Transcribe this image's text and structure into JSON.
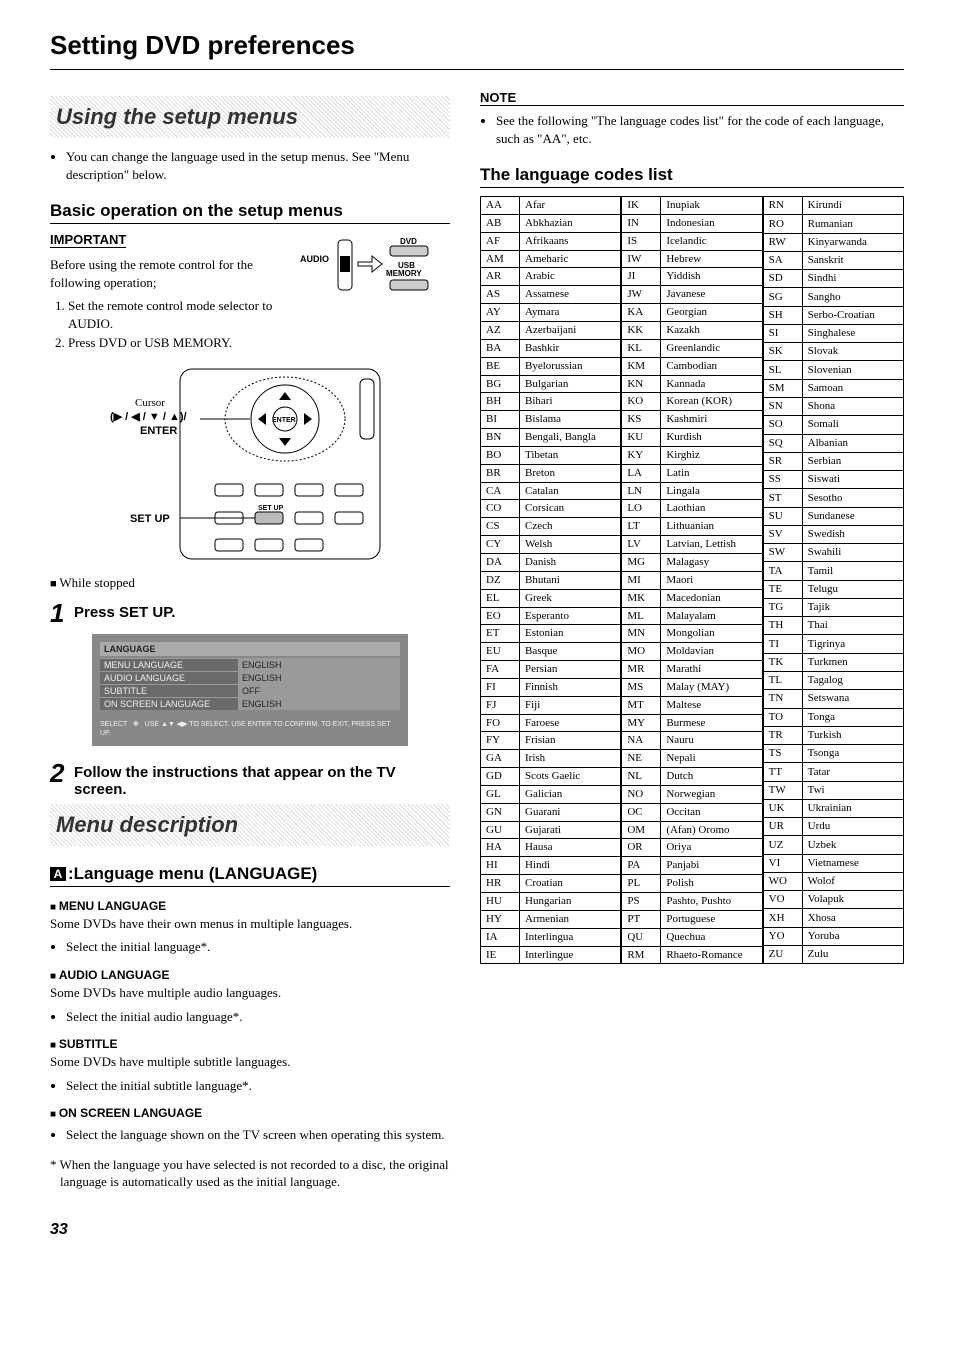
{
  "page_title": "Setting DVD preferences",
  "page_number": "33",
  "left": {
    "h_using": "Using the setup menus",
    "intro_bullet": "You can change the language used in the setup menus. See \"Menu description\" below.",
    "h_basic": "Basic operation on the setup menus",
    "important_label": "IMPORTANT",
    "important_intro": "Before using the remote control for the following operation;",
    "important_1": "Set the remote control mode selector to AUDIO.",
    "important_2": "Press DVD or USB MEMORY.",
    "switch_audio": "AUDIO",
    "switch_dvd": "DVD",
    "switch_usb": "USB MEMORY",
    "remote_cursor_label": "Cursor",
    "remote_cursor_arrows": "(▶ / ◀ / ▼ / ▲)/",
    "remote_enter": "ENTER",
    "remote_setup": "SET UP",
    "while_stopped": "While stopped",
    "step1_num": "1",
    "step1_text": "Press SET UP.",
    "osd_title": "LANGUAGE",
    "osd_rows": [
      {
        "k": "MENU LANGUAGE",
        "v": "ENGLISH"
      },
      {
        "k": "AUDIO LANGUAGE",
        "v": "ENGLISH"
      },
      {
        "k": "SUBTITLE",
        "v": "OFF"
      },
      {
        "k": "ON SCREEN LANGUAGE",
        "v": "ENGLISH"
      }
    ],
    "osd_foot1": "SELECT",
    "osd_foot2": "USE ▲▼ ◀▶ TO SELECT. USE ENTER TO CONFIRM. TO EXIT, PRESS SET UP.",
    "step2_num": "2",
    "step2_text": "Follow the instructions that appear on the TV screen.",
    "h_menu_desc": "Menu description",
    "lang_icon": "A",
    "h_language": ":Language menu (LANGUAGE)",
    "ml_h": "MENU LANGUAGE",
    "ml_t": "Some DVDs have their own menus in multiple languages.",
    "ml_b": "Select the initial language*.",
    "al_h": "AUDIO LANGUAGE",
    "al_t": "Some DVDs have multiple audio languages.",
    "al_b": "Select the initial audio language*.",
    "st_h": "SUBTITLE",
    "st_t": "Some DVDs have multiple subtitle languages.",
    "st_b": "Select the initial subtitle language*.",
    "os_h": "ON SCREEN LANGUAGE",
    "os_b": "Select the language shown on the TV screen when operating this system.",
    "footnote": "* When the language you have selected is not recorded to a disc, the original language is automatically used as the initial language."
  },
  "right": {
    "note_label": "NOTE",
    "note_bullet": "See the following \"The language codes list\" for the code of each language, such as \"AA\", etc.",
    "h_codes": "The language codes list",
    "col1": [
      [
        "AA",
        "Afar"
      ],
      [
        "AB",
        "Abkhazian"
      ],
      [
        "AF",
        "Afrikaans"
      ],
      [
        "AM",
        "Ameharic"
      ],
      [
        "AR",
        "Arabic"
      ],
      [
        "AS",
        "Assamese"
      ],
      [
        "AY",
        "Aymara"
      ],
      [
        "AZ",
        "Azerbaijani"
      ],
      [
        "BA",
        "Bashkir"
      ],
      [
        "BE",
        "Byelorussian"
      ],
      [
        "BG",
        "Bulgarian"
      ],
      [
        "BH",
        "Bihari"
      ],
      [
        "BI",
        "Bislama"
      ],
      [
        "BN",
        "Bengali, Bangla"
      ],
      [
        "BO",
        "Tibetan"
      ],
      [
        "BR",
        "Breton"
      ],
      [
        "CA",
        "Catalan"
      ],
      [
        "CO",
        "Corsican"
      ],
      [
        "CS",
        "Czech"
      ],
      [
        "CY",
        "Welsh"
      ],
      [
        "DA",
        "Danish"
      ],
      [
        "DZ",
        "Bhutani"
      ],
      [
        "EL",
        "Greek"
      ],
      [
        "EO",
        "Esperanto"
      ],
      [
        "ET",
        "Estonian"
      ],
      [
        "EU",
        "Basque"
      ],
      [
        "FA",
        "Persian"
      ],
      [
        "FI",
        "Finnish"
      ],
      [
        "FJ",
        "Fiji"
      ],
      [
        "FO",
        "Faroese"
      ],
      [
        "FY",
        "Frisian"
      ],
      [
        "GA",
        "Irish"
      ],
      [
        "GD",
        "Scots Gaelic"
      ],
      [
        "GL",
        "Galician"
      ],
      [
        "GN",
        "Guarani"
      ],
      [
        "GU",
        "Gujarati"
      ],
      [
        "HA",
        "Hausa"
      ],
      [
        "HI",
        "Hindi"
      ],
      [
        "HR",
        "Croatian"
      ],
      [
        "HU",
        "Hungarian"
      ],
      [
        "HY",
        "Armenian"
      ],
      [
        "IA",
        "Interlingua"
      ],
      [
        "IE",
        "Interlingue"
      ]
    ],
    "col2": [
      [
        "IK",
        "Inupiak"
      ],
      [
        "IN",
        "Indonesian"
      ],
      [
        "IS",
        "Icelandic"
      ],
      [
        "IW",
        "Hebrew"
      ],
      [
        "JI",
        "Yiddish"
      ],
      [
        "JW",
        "Javanese"
      ],
      [
        "KA",
        "Georgian"
      ],
      [
        "KK",
        "Kazakh"
      ],
      [
        "KL",
        "Greenlandic"
      ],
      [
        "KM",
        "Cambodian"
      ],
      [
        "KN",
        "Kannada"
      ],
      [
        "KO",
        "Korean (KOR)"
      ],
      [
        "KS",
        "Kashmiri"
      ],
      [
        "KU",
        "Kurdish"
      ],
      [
        "KY",
        "Kirghiz"
      ],
      [
        "LA",
        "Latin"
      ],
      [
        "LN",
        "Lingala"
      ],
      [
        "LO",
        "Laothian"
      ],
      [
        "LT",
        "Lithuanian"
      ],
      [
        "LV",
        "Latvian, Lettish"
      ],
      [
        "MG",
        "Malagasy"
      ],
      [
        "MI",
        "Maori"
      ],
      [
        "MK",
        "Macedonian"
      ],
      [
        "ML",
        "Malayalam"
      ],
      [
        "MN",
        "Mongolian"
      ],
      [
        "MO",
        "Moldavian"
      ],
      [
        "MR",
        "Marathi"
      ],
      [
        "MS",
        "Malay (MAY)"
      ],
      [
        "MT",
        "Maltese"
      ],
      [
        "MY",
        "Burmese"
      ],
      [
        "NA",
        "Nauru"
      ],
      [
        "NE",
        "Nepali"
      ],
      [
        "NL",
        "Dutch"
      ],
      [
        "NO",
        "Norwegian"
      ],
      [
        "OC",
        "Occitan"
      ],
      [
        "OM",
        "(Afan) Oromo"
      ],
      [
        "OR",
        "Oriya"
      ],
      [
        "PA",
        "Panjabi"
      ],
      [
        "PL",
        "Polish"
      ],
      [
        "PS",
        "Pashto, Pushto"
      ],
      [
        "PT",
        "Portuguese"
      ],
      [
        "QU",
        "Quechua"
      ],
      [
        "RM",
        "Rhaeto-Romance"
      ]
    ],
    "col3": [
      [
        "RN",
        "Kirundi"
      ],
      [
        "RO",
        "Rumanian"
      ],
      [
        "RW",
        "Kinyarwanda"
      ],
      [
        "SA",
        "Sanskrit"
      ],
      [
        "SD",
        "Sindhi"
      ],
      [
        "SG",
        "Sangho"
      ],
      [
        "SH",
        "Serbo-Croatian"
      ],
      [
        "SI",
        "Singhalese"
      ],
      [
        "SK",
        "Slovak"
      ],
      [
        "SL",
        "Slovenian"
      ],
      [
        "SM",
        "Samoan"
      ],
      [
        "SN",
        "Shona"
      ],
      [
        "SO",
        "Somali"
      ],
      [
        "SQ",
        "Albanian"
      ],
      [
        "SR",
        "Serbian"
      ],
      [
        "SS",
        "Siswati"
      ],
      [
        "ST",
        "Sesotho"
      ],
      [
        "SU",
        "Sundanese"
      ],
      [
        "SV",
        "Swedish"
      ],
      [
        "SW",
        "Swahili"
      ],
      [
        "TA",
        "Tamil"
      ],
      [
        "TE",
        "Telugu"
      ],
      [
        "TG",
        "Tajik"
      ],
      [
        "TH",
        "Thai"
      ],
      [
        "TI",
        "Tigrinya"
      ],
      [
        "TK",
        "Turkmen"
      ],
      [
        "TL",
        "Tagalog"
      ],
      [
        "TN",
        "Setswana"
      ],
      [
        "TO",
        "Tonga"
      ],
      [
        "TR",
        "Turkish"
      ],
      [
        "TS",
        "Tsonga"
      ],
      [
        "TT",
        "Tatar"
      ],
      [
        "TW",
        "Twi"
      ],
      [
        "UK",
        "Ukrainian"
      ],
      [
        "UR",
        "Urdu"
      ],
      [
        "UZ",
        "Uzbek"
      ],
      [
        "VI",
        "Vietnamese"
      ],
      [
        "WO",
        "Wolof"
      ],
      [
        "VO",
        "Volapuk"
      ],
      [
        "XH",
        "Xhosa"
      ],
      [
        "YO",
        "Yoruba"
      ],
      [
        "ZU",
        "Zulu"
      ]
    ]
  }
}
